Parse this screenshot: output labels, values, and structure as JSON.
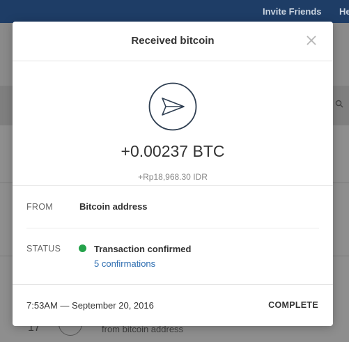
{
  "background": {
    "nav_links": [
      "Invite Friends",
      "He"
    ],
    "row": {
      "date_fragment": "17",
      "description": "from bitcoin address"
    }
  },
  "modal": {
    "title": "Received bitcoin",
    "close_icon": "close-icon",
    "hero_icon": "paper-plane-icon",
    "amount": "+0.00237 BTC",
    "fiat": "+Rp18,968.30 IDR",
    "from_label": "FROM",
    "from_value": "Bitcoin address",
    "status_label": "STATUS",
    "status_value": "Transaction confirmed",
    "status_color": "#24a24a",
    "confirmations": "5 confirmations",
    "timestamp": "7:53AM — September 20, 2016",
    "completion": "COMPLETE"
  },
  "colors": {
    "topbar": "#1e3d66",
    "link": "#2b6cb0"
  }
}
